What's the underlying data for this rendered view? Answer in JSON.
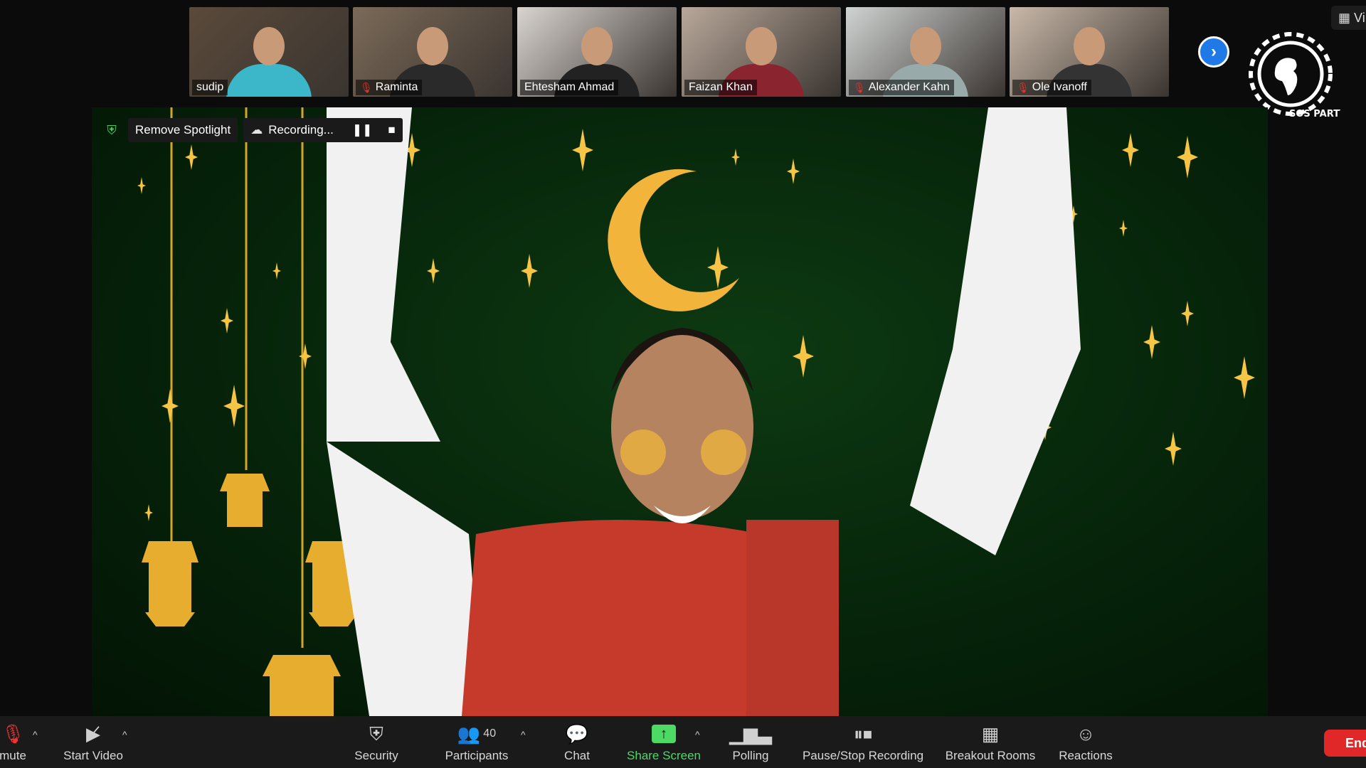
{
  "participants": [
    {
      "name": "sudip",
      "muted": false,
      "bg": "#5a4a3a",
      "shirt": "#3bb7c9"
    },
    {
      "name": "Raminta",
      "muted": true,
      "bg": "#7b6a58",
      "shirt": "#2a2a2a"
    },
    {
      "name": "Ehtesham Ahmad",
      "muted": false,
      "bg": "#d8d4d0",
      "shirt": "#222"
    },
    {
      "name": "Faizan Khan",
      "muted": false,
      "bg": "#b8a89a",
      "shirt": "#8a2530"
    },
    {
      "name": "Alexander Kahn",
      "muted": true,
      "bg": "#cfd3d2",
      "shirt": "#9aa"
    },
    {
      "name": "Ole Ivanoff",
      "muted": true,
      "bg": "#c8b8a8",
      "shirt": "#333"
    }
  ],
  "logo_text": "SOS PARTY",
  "view_label": "Vi",
  "spotlight": {
    "remove_label": "Remove Spotlight",
    "recording_label": "Recording..."
  },
  "toolbar": {
    "mute": "mute",
    "start_video": "Start Video",
    "security": "Security",
    "participants": "Participants",
    "participant_count": "40",
    "chat": "Chat",
    "share_screen": "Share Screen",
    "polling": "Polling",
    "pause_stop_recording": "Pause/Stop Recording",
    "breakout_rooms": "Breakout Rooms",
    "reactions": "Reactions",
    "end": "End"
  },
  "colors": {
    "share_green": "#4cd964",
    "end_red": "#e02828",
    "accent_blue": "#1f7ae8"
  }
}
